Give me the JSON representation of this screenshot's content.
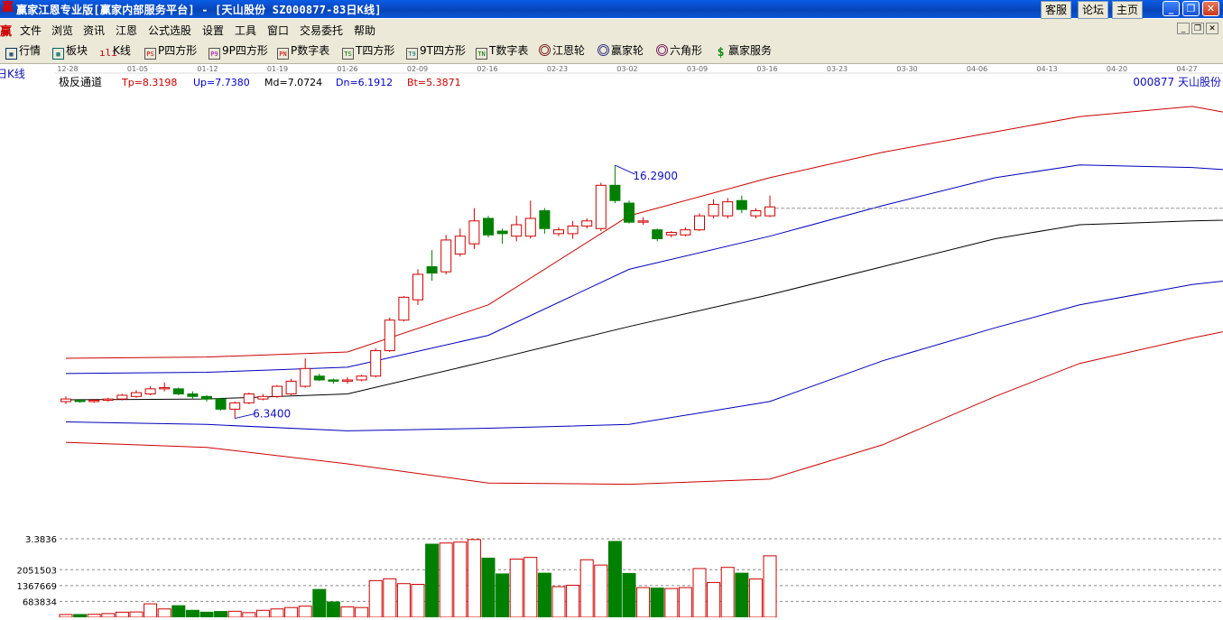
{
  "titlebar": {
    "icon": "win-logo-icon",
    "title": "赢家江恩专业版[赢家内部服务平台] - [天山股份  SZ000877-83日K线]",
    "links": [
      "客服",
      "论坛",
      "主页"
    ]
  },
  "menubar": {
    "logo": "赢",
    "items": [
      "文件",
      "浏览",
      "资讯",
      "江恩",
      "公式选股",
      "设置",
      "工具",
      "窗口",
      "交易委托",
      "帮助"
    ]
  },
  "toolbar": {
    "items": [
      {
        "label": "行情",
        "icon": "grid-icon"
      },
      {
        "label": "板块",
        "icon": "blocks-icon"
      },
      {
        "label": "K线",
        "icon": "candles-icon"
      },
      {
        "label": "P四方形",
        "icon": "PS"
      },
      {
        "label": "9P四方形",
        "icon": "P9"
      },
      {
        "label": "P数字表",
        "icon": "PN"
      },
      {
        "label": "T四方形",
        "icon": "TS"
      },
      {
        "label": "9T四方形",
        "icon": "T9"
      },
      {
        "label": "T数字表",
        "icon": "TN"
      },
      {
        "label": "江恩轮",
        "icon": "wheel-icon"
      },
      {
        "label": "赢家轮",
        "icon": "wheel-icon"
      },
      {
        "label": "六角形",
        "icon": "hexagon-icon"
      },
      {
        "label": "赢家服务",
        "icon": "dollar-icon"
      }
    ]
  },
  "chart_data": {
    "type": "candlestick",
    "period_label": "日K线",
    "date_ticks": [
      "12-28",
      "01-05",
      "01-12",
      "01-19",
      "01-26",
      "02-09",
      "02-16",
      "02-23",
      "03-02",
      "03-09",
      "03-16",
      "03-23",
      "03-30",
      "04-06",
      "04-13",
      "04-20",
      "04-27"
    ],
    "indicator": {
      "name": "极反通道",
      "values": [
        {
          "label": "Tp=8.3198",
          "color": "#cc0000"
        },
        {
          "label": "Up=7.7380",
          "color": "#0000cc"
        },
        {
          "label": "Md=7.0724",
          "color": "#000000"
        },
        {
          "label": "Dn=6.1912",
          "color": "#0000cc"
        },
        {
          "label": "Bt=5.3871",
          "color": "#cc0000"
        }
      ]
    },
    "stock_label": "000877 天山股份",
    "annotations": {
      "high": "16.2900",
      "low": "6.3400"
    },
    "ylim": [
      1.5,
      20.3
    ],
    "last_close": 14.6,
    "candles": [
      [
        7.0,
        7.1,
        6.9,
        7.2
      ],
      [
        7.05,
        7.0,
        6.95,
        7.1
      ],
      [
        7.0,
        7.05,
        6.95,
        7.1
      ],
      [
        7.05,
        7.1,
        7.0,
        7.15
      ],
      [
        7.1,
        7.25,
        7.05,
        7.3
      ],
      [
        7.2,
        7.35,
        7.15,
        7.45
      ],
      [
        7.3,
        7.5,
        7.25,
        7.6
      ],
      [
        7.5,
        7.55,
        7.4,
        7.75
      ],
      [
        7.5,
        7.3,
        7.25,
        7.55
      ],
      [
        7.3,
        7.2,
        7.1,
        7.4
      ],
      [
        7.2,
        7.1,
        7.0,
        7.25
      ],
      [
        7.1,
        6.7,
        6.65,
        7.15
      ],
      [
        6.7,
        6.95,
        6.34,
        7.0
      ],
      [
        6.95,
        7.3,
        6.9,
        7.35
      ],
      [
        7.1,
        7.2,
        7.05,
        7.3
      ],
      [
        7.2,
        7.6,
        7.15,
        7.65
      ],
      [
        7.3,
        7.8,
        7.25,
        7.9
      ],
      [
        7.6,
        8.3,
        7.55,
        8.7
      ],
      [
        8.0,
        7.85,
        7.8,
        8.1
      ],
      [
        7.85,
        7.8,
        7.7,
        7.9
      ],
      [
        7.8,
        7.85,
        7.7,
        7.95
      ],
      [
        7.85,
        8.0,
        7.8,
        8.05
      ],
      [
        8.0,
        9.0,
        7.95,
        9.1
      ],
      [
        9.0,
        10.2,
        8.95,
        10.3
      ],
      [
        10.2,
        11.1,
        10.15,
        11.15
      ],
      [
        11.0,
        12.0,
        10.8,
        12.2
      ],
      [
        12.3,
        12.05,
        11.75,
        12.95
      ],
      [
        12.1,
        13.35,
        12.0,
        13.55
      ],
      [
        12.8,
        13.5,
        12.7,
        13.8
      ],
      [
        13.2,
        14.1,
        13.0,
        14.6
      ],
      [
        14.2,
        13.55,
        13.45,
        14.3
      ],
      [
        13.7,
        13.6,
        13.2,
        13.8
      ],
      [
        13.5,
        13.95,
        13.3,
        14.3
      ],
      [
        13.5,
        14.2,
        13.4,
        14.9
      ],
      [
        14.5,
        13.8,
        13.6,
        14.6
      ],
      [
        13.6,
        13.75,
        13.5,
        13.85
      ],
      [
        13.6,
        13.9,
        13.4,
        14.1
      ],
      [
        13.9,
        14.1,
        13.8,
        14.2
      ],
      [
        13.8,
        15.5,
        13.7,
        15.6
      ],
      [
        15.5,
        14.9,
        14.8,
        16.29
      ],
      [
        14.8,
        14.05,
        14.0,
        14.9
      ],
      [
        14.05,
        14.1,
        13.95,
        14.25
      ],
      [
        13.75,
        13.4,
        13.3,
        13.8
      ],
      [
        13.55,
        13.65,
        13.45,
        13.7
      ],
      [
        13.55,
        13.75,
        13.5,
        13.85
      ],
      [
        13.75,
        14.3,
        13.7,
        14.4
      ],
      [
        14.3,
        14.75,
        14.2,
        14.95
      ],
      [
        14.3,
        14.85,
        14.2,
        15.0
      ],
      [
        14.9,
        14.55,
        14.4,
        15.1
      ],
      [
        14.3,
        14.5,
        14.2,
        14.6
      ],
      [
        14.3,
        14.65,
        14.25,
        15.1
      ]
    ],
    "channel": {
      "top_red": [
        [
          0,
          8.7
        ],
        [
          10,
          8.75
        ],
        [
          20,
          8.95
        ],
        [
          30,
          10.8
        ],
        [
          40,
          14.3
        ],
        [
          50,
          15.8
        ],
        [
          58,
          16.8
        ],
        [
          66,
          17.6
        ],
        [
          72,
          18.2
        ],
        [
          80,
          18.6
        ],
        [
          82,
          18.4
        ],
        [
          88,
          17.8
        ]
      ],
      "upper_blue": [
        [
          0,
          8.1
        ],
        [
          10,
          8.15
        ],
        [
          20,
          8.35
        ],
        [
          30,
          9.6
        ],
        [
          40,
          12.2
        ],
        [
          50,
          13.5
        ],
        [
          58,
          14.7
        ],
        [
          66,
          15.8
        ],
        [
          72,
          16.3
        ],
        [
          80,
          16.2
        ],
        [
          88,
          15.9
        ]
      ],
      "middle_black": [
        [
          0,
          7.07
        ],
        [
          10,
          7.1
        ],
        [
          20,
          7.3
        ],
        [
          30,
          8.6
        ],
        [
          40,
          9.95
        ],
        [
          50,
          11.2
        ],
        [
          58,
          12.3
        ],
        [
          66,
          13.4
        ],
        [
          72,
          13.95
        ],
        [
          80,
          14.1
        ],
        [
          88,
          14.2
        ]
      ],
      "lower_blue": [
        [
          0,
          6.2
        ],
        [
          10,
          6.1
        ],
        [
          20,
          5.85
        ],
        [
          30,
          5.95
        ],
        [
          40,
          6.1
        ],
        [
          50,
          7.0
        ],
        [
          58,
          8.6
        ],
        [
          66,
          9.9
        ],
        [
          72,
          10.8
        ],
        [
          80,
          11.6
        ],
        [
          88,
          12.1
        ]
      ],
      "bottom_red": [
        [
          0,
          5.4
        ],
        [
          10,
          5.2
        ],
        [
          20,
          4.55
        ],
        [
          30,
          3.8
        ],
        [
          40,
          3.75
        ],
        [
          50,
          3.95
        ],
        [
          58,
          5.3
        ],
        [
          66,
          7.2
        ],
        [
          72,
          8.5
        ],
        [
          80,
          9.5
        ],
        [
          88,
          10.4
        ]
      ]
    },
    "volume": {
      "ticks": [
        {
          "label": "3.3836",
          "value": 3383600
        },
        {
          "label": "2051503",
          "value": 2051503
        },
        {
          "label": "1367669",
          "value": 1367669
        },
        {
          "label": "683834",
          "value": 683834
        }
      ],
      "max": 3383600,
      "values": [
        120000,
        120000,
        130000,
        160000,
        220000,
        230000,
        580000,
        360000,
        500000,
        300000,
        220000,
        250000,
        260000,
        200000,
        300000,
        360000,
        420000,
        480000,
        1200000,
        660000,
        450000,
        420000,
        1580000,
        1660000,
        1450000,
        1420000,
        3150000,
        3200000,
        3240000,
        3350000,
        2550000,
        1870000,
        2510000,
        2580000,
        1900000,
        1320000,
        1380000,
        2480000,
        2250000,
        3270000,
        1890000,
        1280000,
        1260000,
        1240000,
        1280000,
        2100000,
        1500000,
        2150000,
        1900000,
        1650000,
        2650000
      ]
    }
  }
}
